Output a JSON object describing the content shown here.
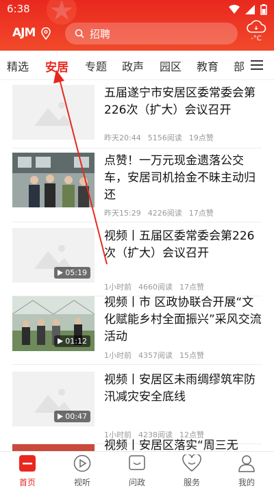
{
  "status": {
    "time": "6:38"
  },
  "header": {
    "logo": "AJM",
    "search_text": "招聘",
    "weather_temp": "-°C"
  },
  "tabs": [
    {
      "label": "精选"
    },
    {
      "label": "安居"
    },
    {
      "label": "专题"
    },
    {
      "label": "政声"
    },
    {
      "label": "园区"
    },
    {
      "label": "教育"
    },
    {
      "label": "部"
    }
  ],
  "feed": [
    {
      "title": "五届遂宁市安居区委常委会第226次（扩大）会议召开",
      "meta": [
        "昨天20:44",
        "5156阅读",
        "19点赞"
      ],
      "duration": ""
    },
    {
      "title": "点赞！一万元现金遗落公交车，安居司机拾金不昧主动归还",
      "meta": [
        "昨天15:29",
        "4226阅读",
        "17点赞"
      ],
      "duration": ""
    },
    {
      "title": "视频丨五届区委常委会第226次（扩大）会议召开",
      "meta": [
        "1小时前",
        "4660阅读",
        "17点赞"
      ],
      "duration": "05:19"
    },
    {
      "title": "视频丨市 区政协联合开展“文化赋能乡村全面振兴”采风交流活动",
      "meta": [
        "1小时前",
        "4357阅读",
        "15点赞"
      ],
      "duration": "01:12"
    },
    {
      "title": "视频丨安居区未雨绸缪筑牢防汛减灾安全底线",
      "meta": [
        "1小时前",
        "4238阅读",
        "12点赞"
      ],
      "duration": "00:47"
    },
    {
      "title": "视频丨安居区落实“周三无",
      "meta": [],
      "duration": ""
    }
  ],
  "bottom_nav": [
    {
      "label": "首页"
    },
    {
      "label": "视听"
    },
    {
      "label": "问政"
    },
    {
      "label": "服务"
    },
    {
      "label": "我的"
    }
  ],
  "colors": {
    "brand": "#e8281e"
  }
}
